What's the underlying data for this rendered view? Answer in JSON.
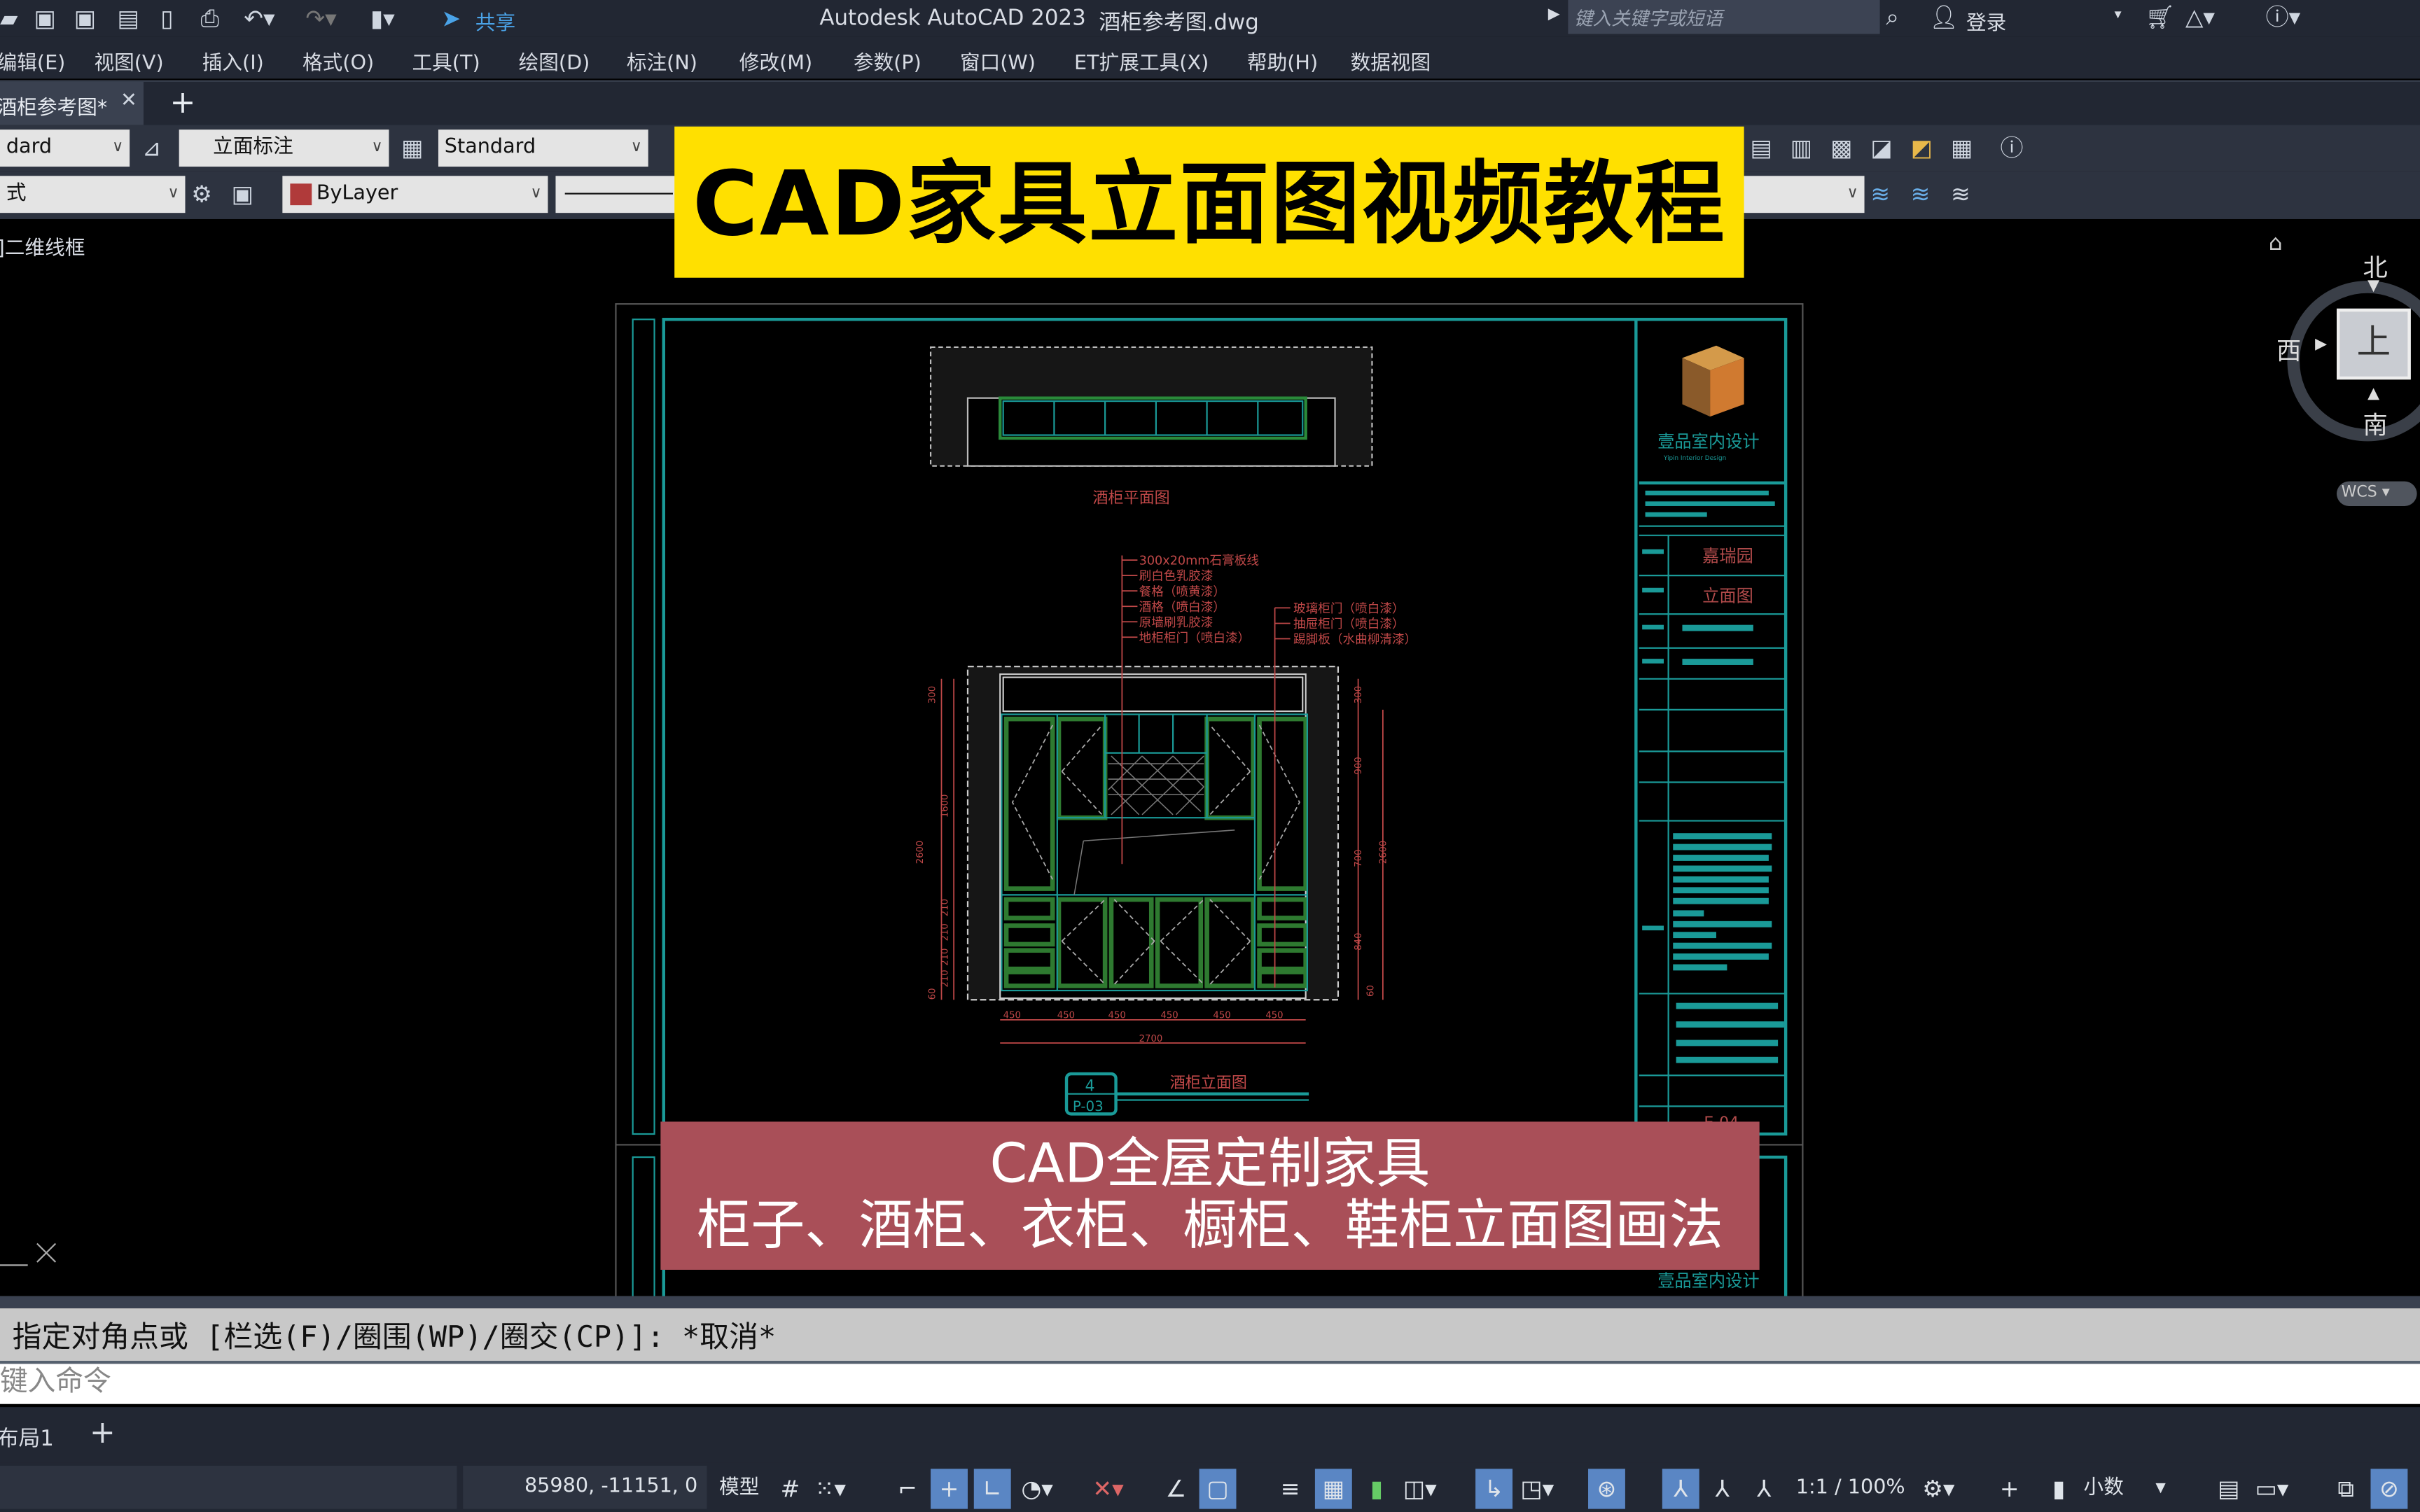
{
  "titlebar": {
    "share_label": "共享",
    "title": "Autodesk AutoCAD 2023",
    "filename": "酒柜参考图.dwg",
    "search_placeholder": "键入关键字或短语",
    "login_label": "登录"
  },
  "menu": [
    "编辑(E)",
    "视图(V)",
    "插入(I)",
    "格式(O)",
    "工具(T)",
    "绘图(D)",
    "标注(N)",
    "修改(M)",
    "参数(P)",
    "窗口(W)",
    "ET扩展工具(X)",
    "帮助(H)",
    "数据视图"
  ],
  "file_tab": {
    "label": "酒柜参考图*"
  },
  "toolbar": {
    "text_style": "dard",
    "dim_style": "立面标注",
    "table_style": "Standard",
    "workspace": "式",
    "color": "ByLayer",
    "color_swatch": "#b03a3a"
  },
  "viewport": {
    "label": "]二维线框"
  },
  "viewcube": {
    "north": "北",
    "south": "南",
    "west": "西",
    "top": "上",
    "wcs": "WCS"
  },
  "banner_top": "CAD家具立面图视频教程",
  "banner_bottom": {
    "line1": "CAD全屋定制家具",
    "line2": "柜子、酒柜、衣柜、橱柜、鞋柜立面图画法"
  },
  "drawing": {
    "plan_title": "酒柜平面图",
    "elevation_title": "酒柜立面图",
    "callout_number": "4",
    "callout_sheet": "P-03",
    "notes_left": [
      "300x20mm石膏板线",
      "刷白色乳胶漆",
      "餐格（喷黄漆）",
      "酒格（喷白漆）",
      "原墙刷乳胶漆",
      "地柜柜门（喷白漆）"
    ],
    "notes_right": [
      "玻璃柜门（喷白漆）",
      "抽屉柜门（喷白漆）",
      "踢脚板（水曲柳清漆）"
    ],
    "dims_bottom": [
      "450",
      "450",
      "450",
      "450",
      "450",
      "450"
    ],
    "dim_total": "2700",
    "dims_left": [
      "300",
      "1600",
      "210",
      "210",
      "210",
      "210",
      "60",
      "2600"
    ],
    "dims_right": [
      "300",
      "900",
      "700",
      "840",
      "60",
      "2600"
    ],
    "titleblock": {
      "company": "壹品室内设计",
      "company_en": "Yipin Interior Design",
      "project": "嘉瑞园",
      "drawing_name": "立面图",
      "sheet": "E-04",
      "company_repeat": "壹品室内设计"
    }
  },
  "command": {
    "history": "指定对角点或 [栏选(F)/圈围(WP)/圈交(CP)]: *取消*",
    "input_placeholder": "键入命令"
  },
  "layout_tabs": {
    "tab": "布局1"
  },
  "status": {
    "coords": "85980, -11151, 0",
    "model": "模型",
    "scale": "1:1 / 100%",
    "units": "小数"
  }
}
